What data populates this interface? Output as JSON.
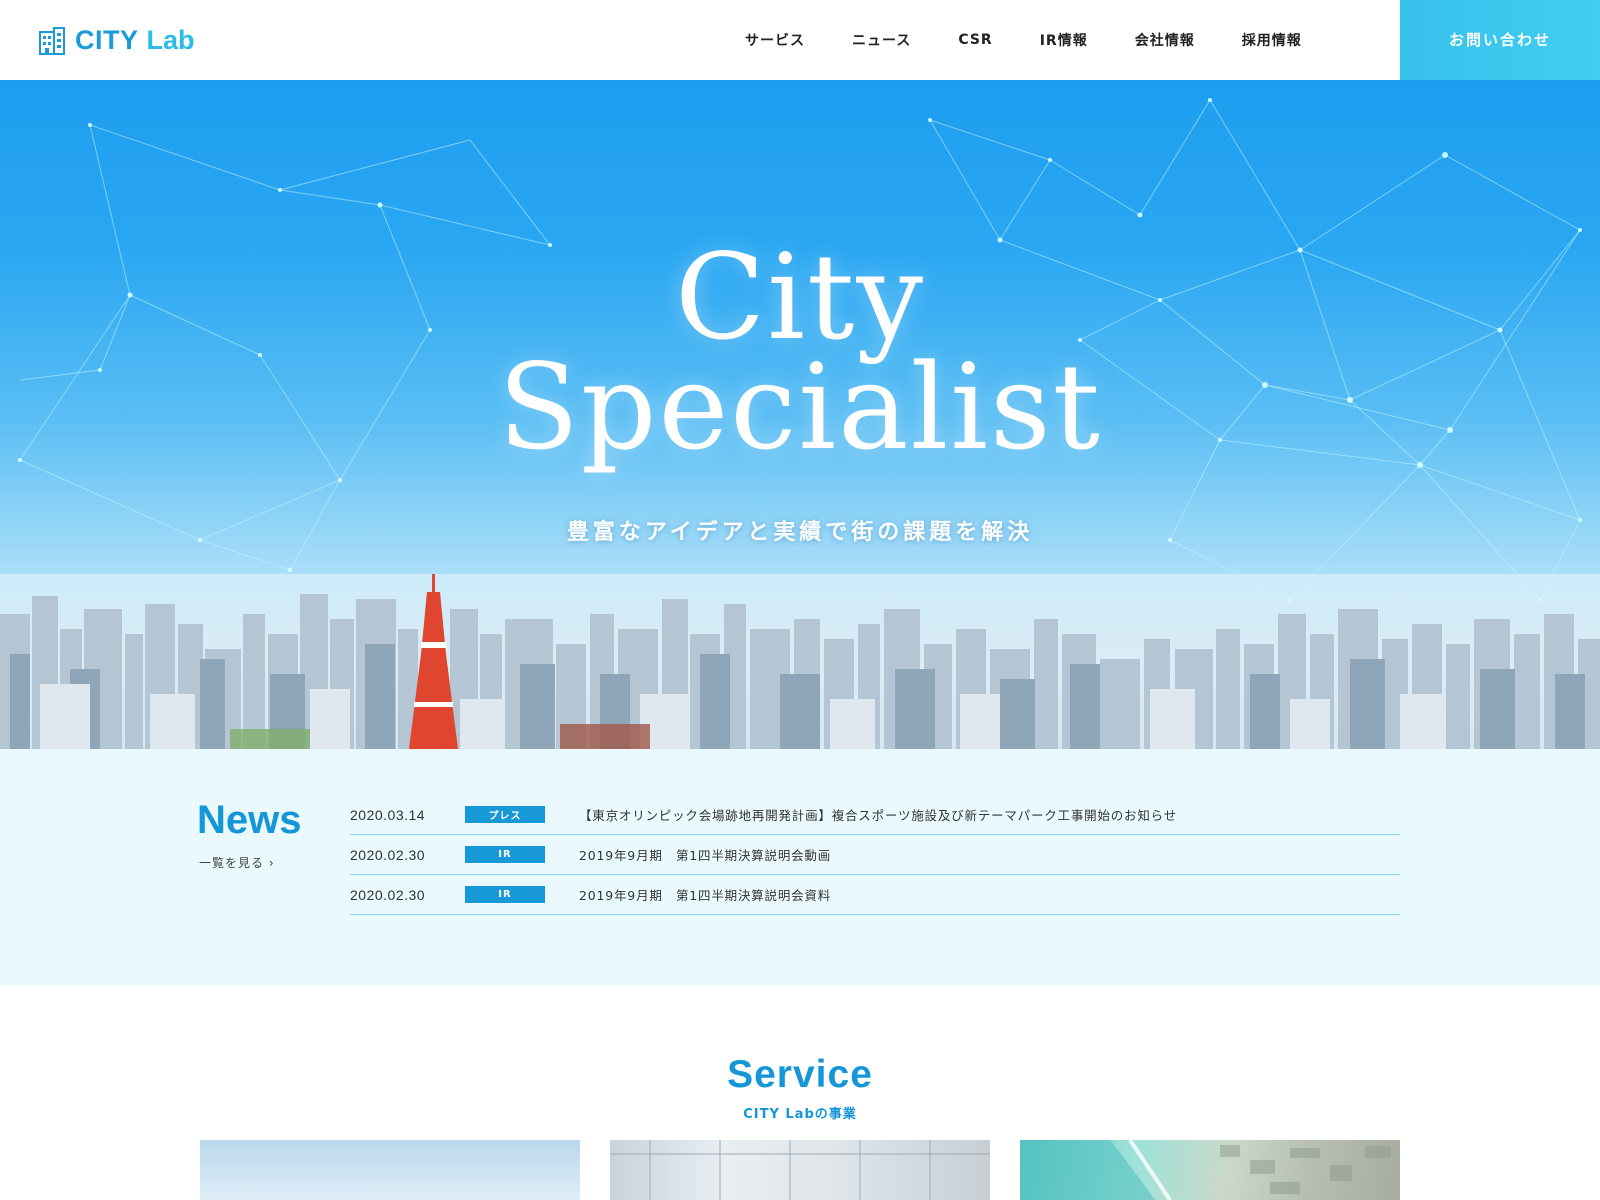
{
  "header": {
    "logo_city": "CITY",
    "logo_lab": "Lab",
    "nav": [
      "サービス",
      "ニュース",
      "CSR",
      "IR情報",
      "会社情報",
      "採用情報"
    ],
    "contact_label": "お問い合わせ"
  },
  "hero": {
    "title_line1": "City",
    "title_line2": "Specialist",
    "subtitle": "豊富なアイデアと実績で街の課題を解決"
  },
  "news": {
    "title": "News",
    "more_label": "一覧を見る ›",
    "items": [
      {
        "date": "2020.03.14",
        "category": "プレス",
        "text": "【東京オリンピック会場跡地再開発計画】複合スポーツ施設及び新テーマパーク工事開始のお知らせ"
      },
      {
        "date": "2020.02.30",
        "category": "IR",
        "text": "2019年9月期　第1四半期決算説明会動画"
      },
      {
        "date": "2020.02.30",
        "category": "IR",
        "text": "2019年9月期　第1四半期決算説明会資料"
      }
    ]
  },
  "service": {
    "title": "Service",
    "subtitle": "CITY Labの事業"
  },
  "colors": {
    "brand": "#1596d8",
    "accent": "#2bbde8",
    "contact_bg": "#3ec8ee",
    "badge": "#1899d7",
    "news_bg": "#e9f9fd"
  },
  "icons": {
    "logo": "building-icon"
  }
}
